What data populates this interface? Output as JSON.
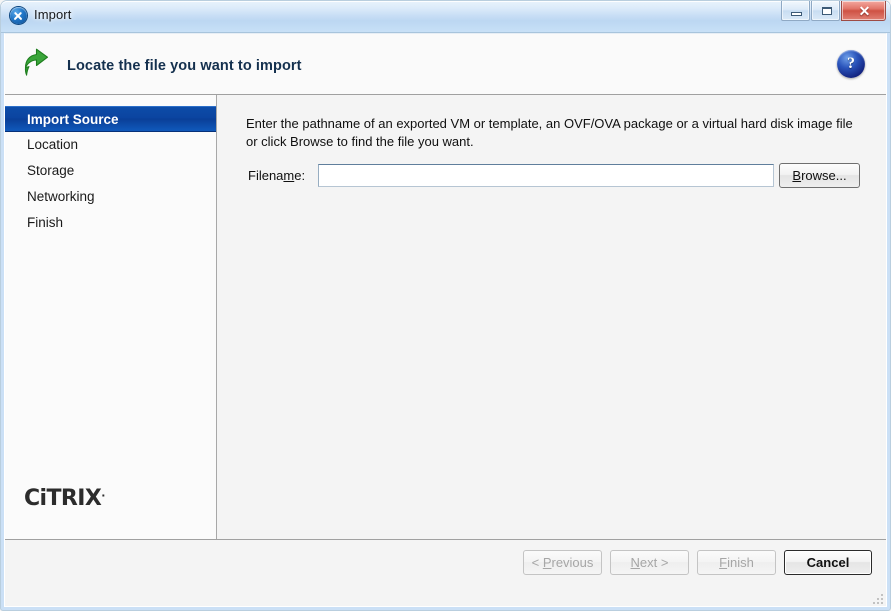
{
  "window": {
    "title": "Import",
    "app_icon": "xencenter-circle-x-icon",
    "controls": {
      "minimize": "minimize-icon",
      "maximize": "maximize-icon",
      "close": "✕"
    }
  },
  "header": {
    "icon": "green-back-arrow-icon",
    "title": "Locate the file you want to import",
    "help": "?"
  },
  "sidebar": {
    "steps": [
      {
        "label": "Import Source",
        "selected": true
      },
      {
        "label": "Location",
        "selected": false
      },
      {
        "label": "Storage",
        "selected": false
      },
      {
        "label": "Networking",
        "selected": false
      },
      {
        "label": "Finish",
        "selected": false
      }
    ],
    "logo": "CiTRIX",
    "logo_tm": "."
  },
  "content": {
    "instruction": "Enter the pathname of an exported VM or template, an OVF/OVA package or a virtual hard disk image file or click Browse to find the file you want.",
    "filename_label_pre": "Filena",
    "filename_label_accel": "m",
    "filename_label_post": "e:",
    "filename_value": "",
    "filename_placeholder": "",
    "browse_accel": "B",
    "browse_label": "rowse..."
  },
  "footer": {
    "buttons": [
      {
        "label": "< ",
        "accel": "P",
        "rest": "revious",
        "disabled": true,
        "name": "previous-button"
      },
      {
        "label": "",
        "accel": "N",
        "rest": "ext >",
        "disabled": true,
        "name": "next-button"
      },
      {
        "label": "",
        "accel": "F",
        "rest": "inish",
        "disabled": true,
        "name": "finish-button"
      },
      {
        "label": "",
        "accel": "",
        "rest": "Cancel",
        "disabled": false,
        "name": "cancel-button"
      }
    ]
  },
  "colors": {
    "accent_selected": "#0b44a0",
    "title_bar": "#c6ddf5",
    "close_button": "#cf5244",
    "help_button": "#2a54bb",
    "header_icon": "#3aa53a"
  }
}
